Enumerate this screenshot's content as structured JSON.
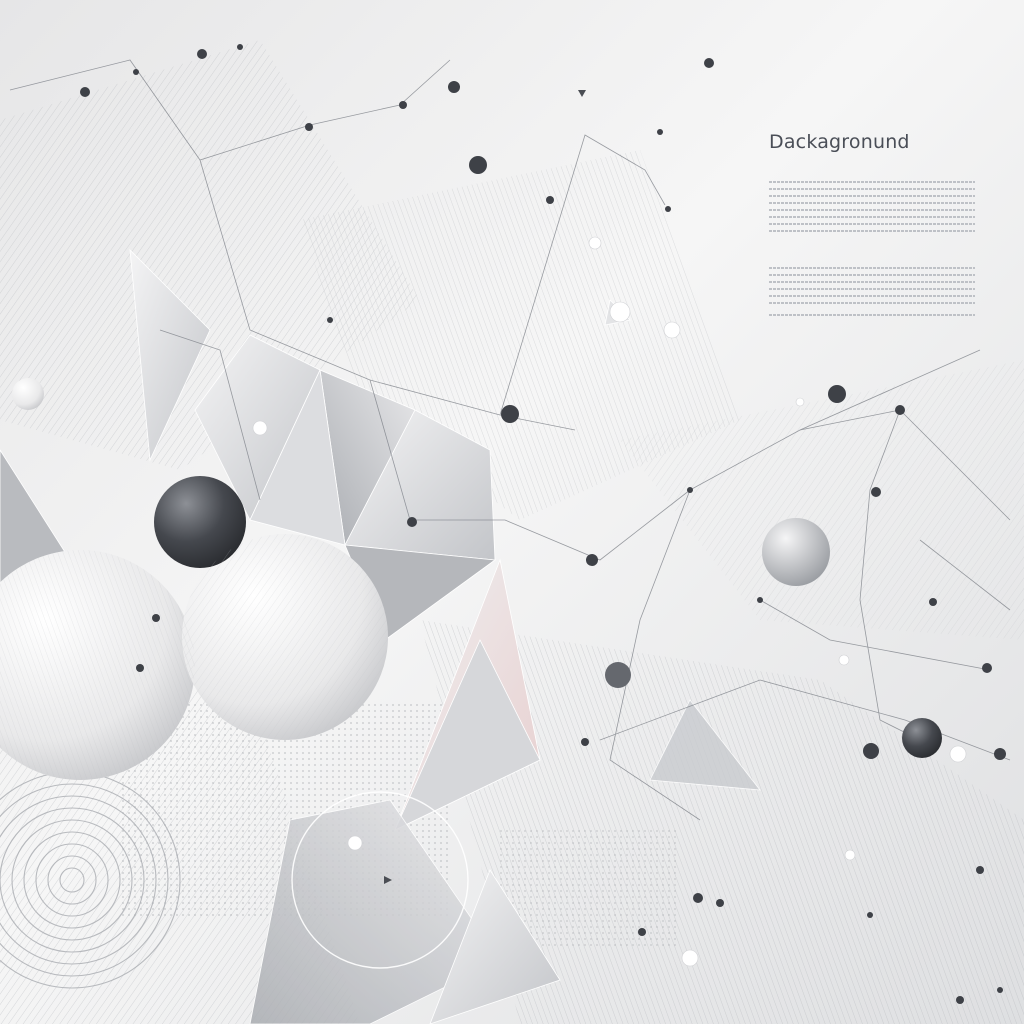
{
  "page": {
    "heading": "Dackagronund"
  },
  "palette": {
    "background": "#f3f3f3",
    "sphere_light": "#f2f2f2",
    "sphere_dark": "#3c3f44",
    "line": "#6b6f76",
    "dot": "#3a3d42"
  }
}
